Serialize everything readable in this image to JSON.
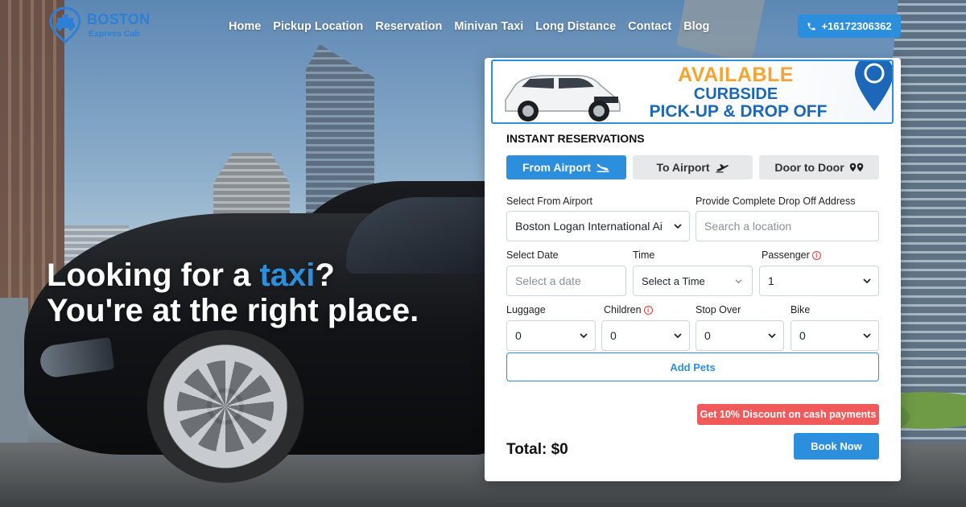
{
  "brand": {
    "line1": "BOSTON",
    "line2": "Express Cab",
    "color": "#2e7fd6"
  },
  "nav": {
    "items": [
      "Home",
      "Pickup Location",
      "Reservation",
      "Minivan Taxi",
      "Long Distance",
      "Contact",
      "Blog"
    ],
    "phone": "+16172306362",
    "phone_icon": "phone-icon"
  },
  "hero": {
    "line1_pre": "Looking for a ",
    "line1_accent": "taxi",
    "line1_post": "?",
    "line2": "You're at the right place."
  },
  "banner": {
    "line1": "AVAILABLE",
    "line2": "CURBSIDE",
    "line3": "PICK-UP & DROP OFF"
  },
  "form": {
    "title": "INSTANT RESERVATIONS",
    "tabs": [
      {
        "label": "From Airport",
        "icon": "plane-landing-icon",
        "active": true
      },
      {
        "label": "To Airport",
        "icon": "plane-takeoff-icon",
        "active": false
      },
      {
        "label": "Door to Door",
        "icon": "map-pins-icon",
        "active": false
      }
    ],
    "airport_label": "Select From Airport",
    "airport_value": "Boston Logan International Ai",
    "address_label": "Provide Complete Drop Off Address",
    "address_placeholder": "Search a location",
    "date_label": "Select Date",
    "date_placeholder": "Select a date",
    "time_label": "Time",
    "time_value": "Select a Time",
    "passenger_label": "Passenger",
    "passenger_value": "1",
    "luggage_label": "Luggage",
    "luggage_value": "0",
    "children_label": "Children",
    "children_value": "0",
    "stopover_label": "Stop Over",
    "stopover_value": "0",
    "bike_label": "Bike",
    "bike_value": "0",
    "add_pets": "Add Pets",
    "discount": "Get 10% Discount on cash payments",
    "total": "Total: $0",
    "book": "Book Now"
  },
  "colors": {
    "primary": "#2b8fde",
    "discount": "#f05a5a",
    "banner_orange": "#f4a531",
    "banner_blue": "#1d67b8"
  }
}
